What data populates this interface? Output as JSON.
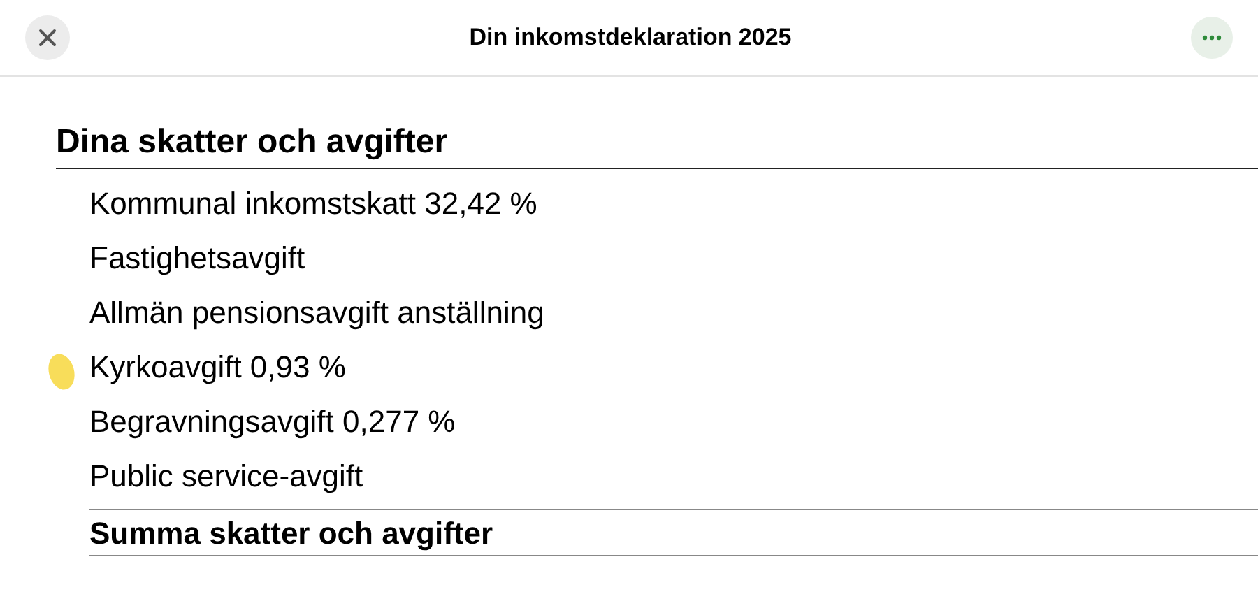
{
  "header": {
    "title": "Din inkomstdeklaration 2025"
  },
  "section": {
    "heading": "Dina skatter och avgifter",
    "rows": [
      {
        "label": "Kommunal inkomstskatt 32,42 %",
        "highlighted": false
      },
      {
        "label": "Fastighetsavgift",
        "highlighted": false
      },
      {
        "label": "Allmän pensionsavgift anställning",
        "highlighted": false
      },
      {
        "label": "Kyrkoavgift 0,93 %",
        "highlighted": true
      },
      {
        "label": "Begravningsavgift 0,277 %",
        "highlighted": false
      },
      {
        "label": "Public service-avgift",
        "highlighted": false
      }
    ],
    "total": "Summa skatter och avgifter"
  }
}
